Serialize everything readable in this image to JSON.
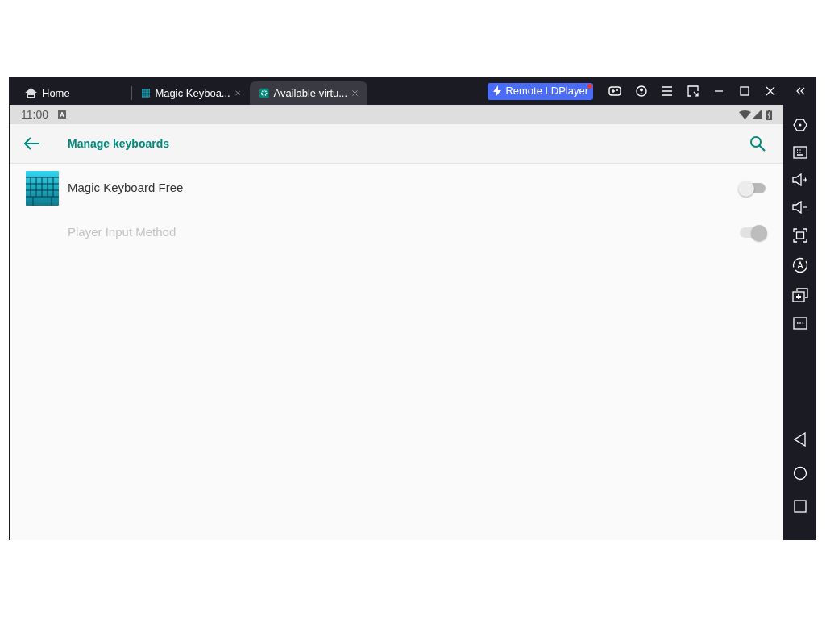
{
  "tabs": [
    {
      "label": "Home",
      "kind": "home",
      "selected": false
    },
    {
      "label": "Magic Keyboa...",
      "kind": "keyboard",
      "selected": false
    },
    {
      "label": "Available virtu...",
      "kind": "settings",
      "selected": true
    }
  ],
  "remote_button": {
    "label": "Remote LDPlayer",
    "badge": true
  },
  "status_bar": {
    "time": "11:00"
  },
  "app_bar": {
    "title": "Manage keyboards"
  },
  "keyboards": [
    {
      "name": "Magic Keyboard Free",
      "kind": "app",
      "on": false,
      "disabled": false
    },
    {
      "name": "Player Input Method",
      "kind": "system",
      "on": true,
      "disabled": true
    }
  ]
}
